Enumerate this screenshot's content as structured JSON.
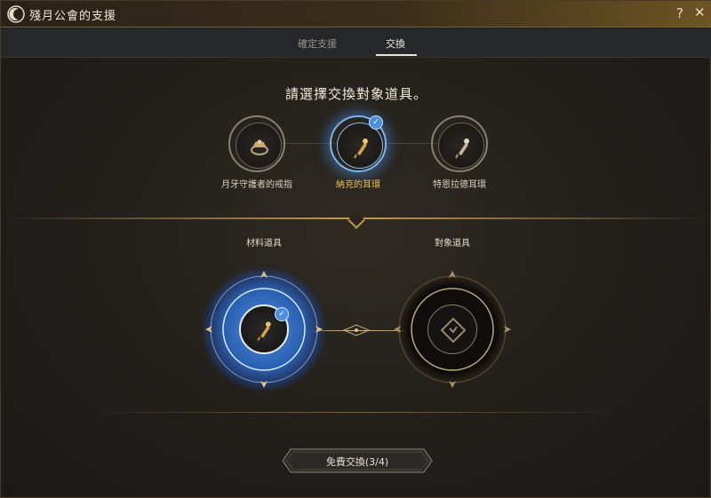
{
  "window": {
    "title": "殘月公會的支援",
    "help_icon": "?",
    "close_icon": "✕"
  },
  "tabs": [
    {
      "label": "確定支援"
    },
    {
      "label": "交換",
      "active": true
    }
  ],
  "prompt": "請選擇交換對象道具。",
  "options": [
    {
      "label": "月牙守護者的戒指",
      "icon": "ring-icon",
      "selected": false
    },
    {
      "label": "納克的耳環",
      "icon": "earring-icon",
      "selected": true
    },
    {
      "label": "特恩拉德耳環",
      "icon": "earring-icon",
      "selected": false
    }
  ],
  "slots": {
    "material_label": "材料道具",
    "target_label": "對象道具"
  },
  "exchange_button": {
    "label": "免費交換(3/4)"
  },
  "colors": {
    "accent_blue": "#4a8fe0",
    "gold": "#c89b4a",
    "selected_text": "#e9c35a"
  }
}
